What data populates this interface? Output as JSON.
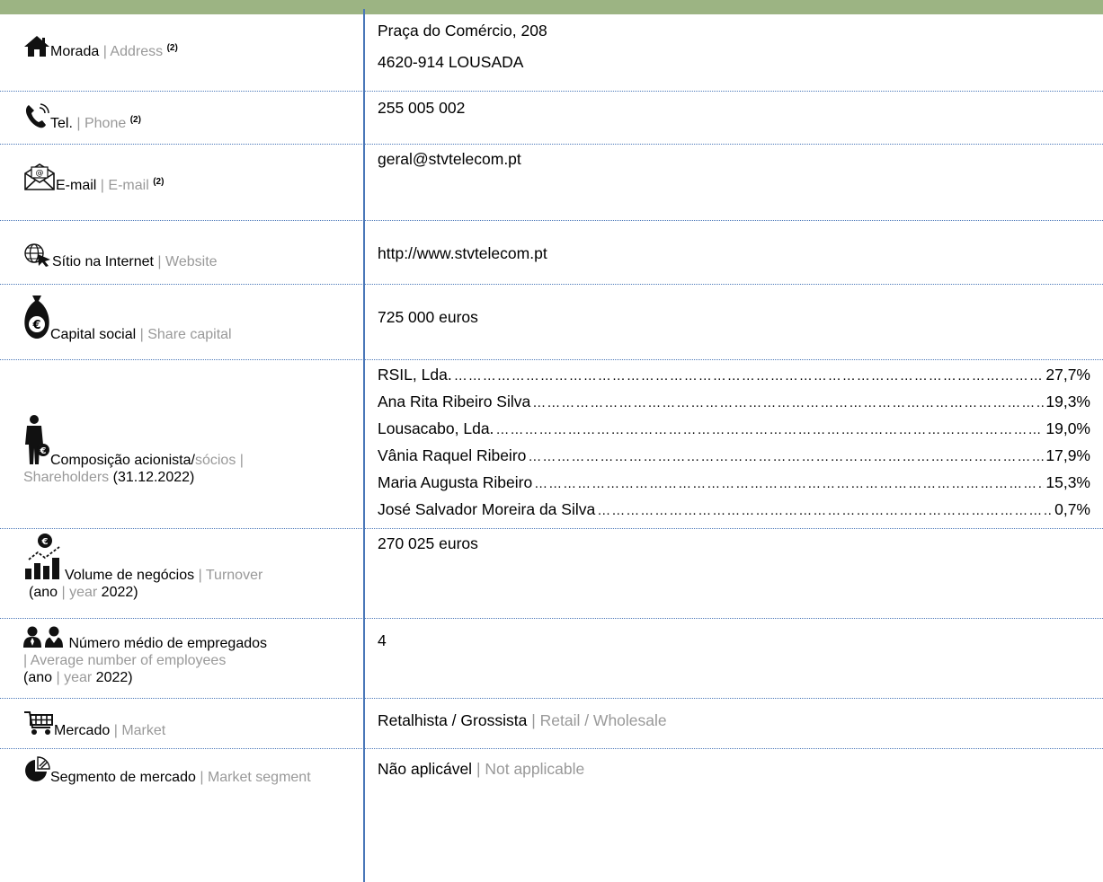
{
  "rows": [
    {
      "label": "Morada",
      "label_en": "Address",
      "note": "(2)",
      "icon": "house-icon",
      "lines": [
        "Praça do Comércio, 208",
        "4620-914 LOUSADA"
      ]
    },
    {
      "label": "Tel.",
      "label_en": "Phone",
      "note": "(2)",
      "icon": "phone-icon",
      "lines": [
        "255 005 002"
      ]
    },
    {
      "label": "E-mail",
      "label_en": "E-mail",
      "note": "(2)",
      "icon": "envelope-icon",
      "lines": [
        "geral@stvtelecom.pt"
      ]
    },
    {
      "label": "Sítio na Internet",
      "label_en": "Website",
      "icon": "globe-cursor-icon",
      "lines": [
        "http://www.stvtelecom.pt"
      ]
    },
    {
      "label": "Capital social",
      "label_en": "Share capital",
      "icon": "money-bag-icon",
      "lines": [
        "725 000 euros"
      ]
    },
    {
      "label": "Composição acionista/",
      "label_en_1": "sócios",
      "label_sep": " | ",
      "label_en_2": "Shareholders",
      "label_date": " (31.12.2022)",
      "icon": "shareholder-icon",
      "shareholders": [
        {
          "name": "RSIL, Lda.",
          "pct": "27,7%"
        },
        {
          "name": "Ana Rita Ribeiro Silva",
          "pct": "19,3%"
        },
        {
          "name": "Lousacabo, Lda.",
          "pct": "19,0%"
        },
        {
          "name": "Vânia Raquel Ribeiro",
          "pct": "17,9%"
        },
        {
          "name": "Maria Augusta Ribeiro",
          "pct": "15,3%"
        },
        {
          "name": "José Salvador Moreira da Silva",
          "pct": "0,7%"
        }
      ]
    },
    {
      "label": "Volume de negócios",
      "label_en": "Turnover",
      "year_pt": "(ano",
      "year_en": "year",
      "year_val": "2022)",
      "icon": "turnover-chart-icon",
      "lines": [
        "270 025 euros"
      ]
    },
    {
      "label": "Número médio de empregados",
      "label_en": "| Average number of employees",
      "year_pt": "(ano",
      "year_en": "year",
      "year_val": "2022)",
      "icon": "employees-icon",
      "lines": [
        "4"
      ]
    },
    {
      "label": "Mercado",
      "label_en": "Market",
      "icon": "cart-icon",
      "value_pt": "Retalhista / Grossista",
      "value_en": "Retail / Wholesale"
    },
    {
      "label": "Segmento de mercado",
      "label_en": "Market segment",
      "icon": "pie-chart-icon",
      "value_pt": "Não aplicável",
      "value_en": "Not applicable"
    }
  ],
  "separator": "|"
}
